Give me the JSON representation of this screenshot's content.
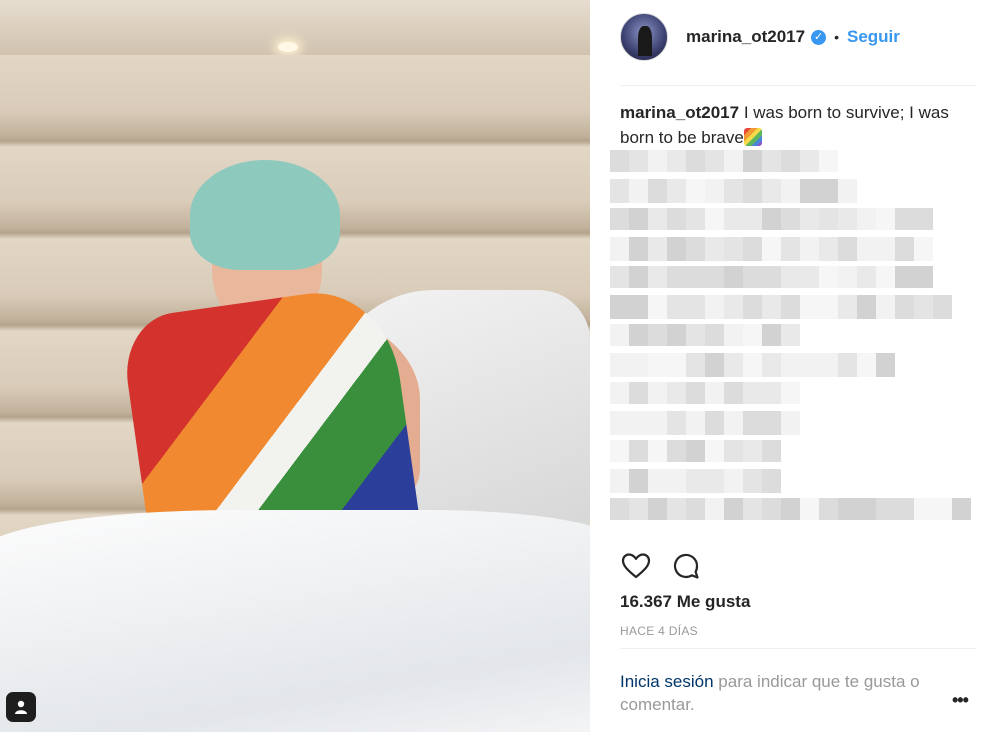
{
  "post": {
    "username": "marina_ot2017",
    "verified": true,
    "separator": "•",
    "follow_label": "Seguir",
    "caption_username": "marina_ot2017",
    "caption_text": "I was born to survive; I was born to be brave",
    "caption_emoji": "rainbow-emoji",
    "likes": "16.367 Me gusta",
    "time": "HACE 4 DÍAS",
    "login_link": "Inicia sesión",
    "login_text": "para indicar que te gusta o comentar.",
    "more_label": "•••"
  },
  "icons": {
    "like": "heart-icon",
    "comment": "comment-icon",
    "tagged": "user-tag-icon",
    "verified": "verified-badge-icon",
    "more": "more-options-icon"
  },
  "colors": {
    "accent": "#3897f0",
    "link": "#003569",
    "muted": "#999999",
    "text": "#262626"
  }
}
